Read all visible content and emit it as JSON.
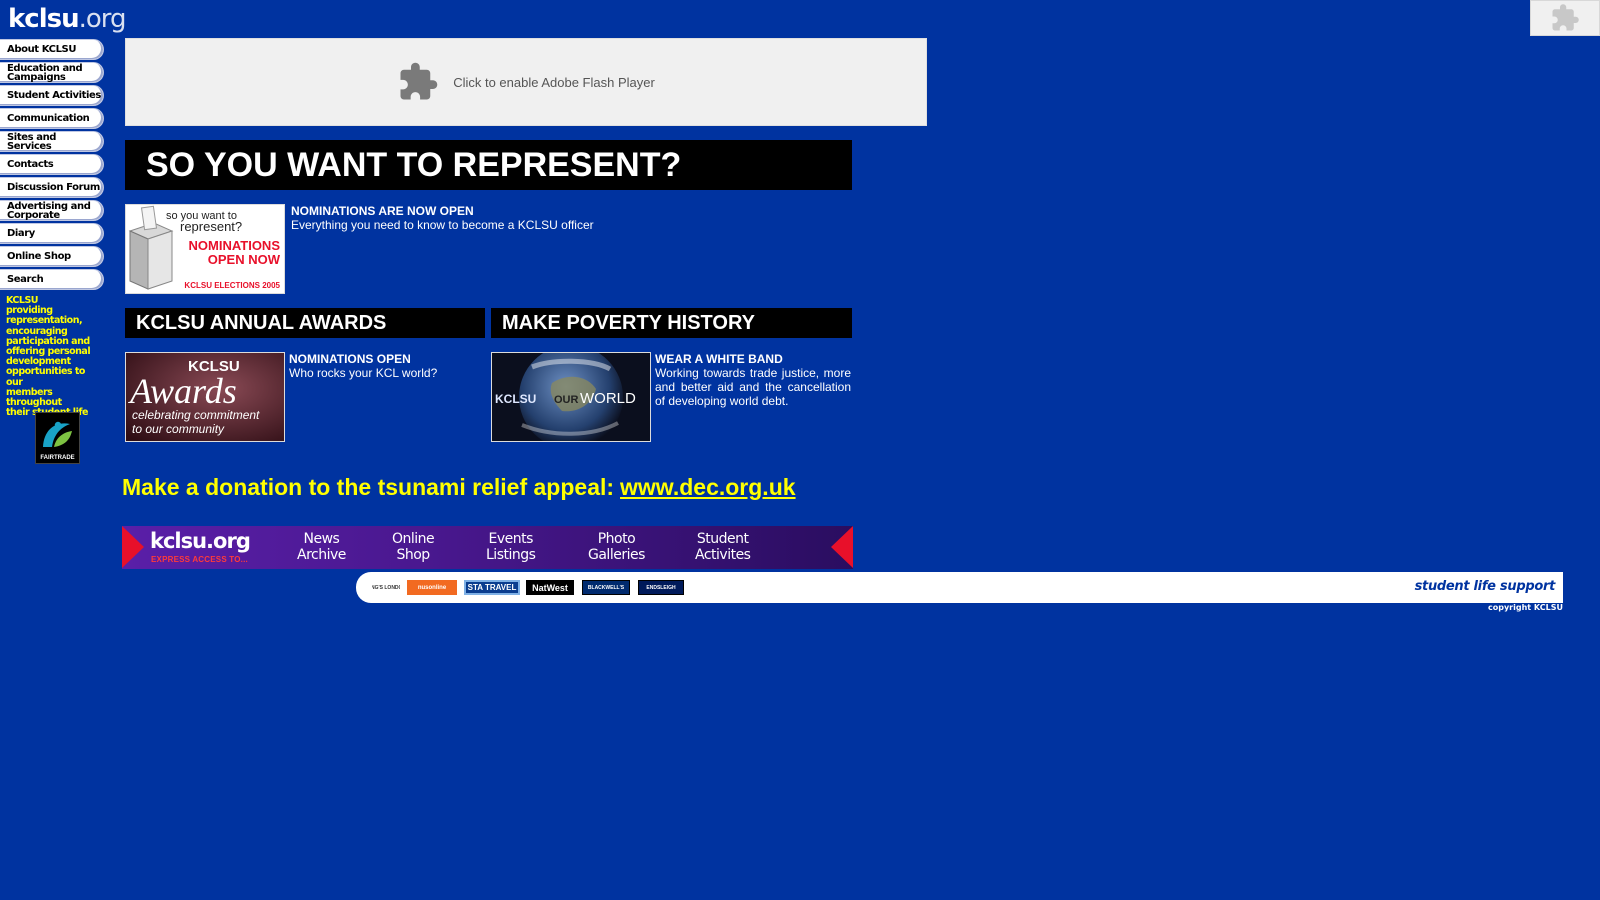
{
  "site": {
    "logo_bold": "kclsu",
    "logo_light": ".org"
  },
  "nav": {
    "items": [
      [
        "About KCLSU"
      ],
      [
        "Education and",
        "Campaigns"
      ],
      [
        "Student Activities"
      ],
      [
        "Communication"
      ],
      [
        "Sites and Services"
      ],
      [
        "Contacts"
      ],
      [
        "Discussion Forum"
      ],
      [
        "Advertising and",
        "Corporate"
      ],
      [
        "Diary"
      ],
      [
        "Online Shop"
      ],
      [
        "Search"
      ]
    ]
  },
  "tagline": [
    "KCLSU",
    "providing",
    "representation,",
    "encouraging",
    "participation and",
    "offering personal",
    "development",
    "opportunities to our",
    "members throughout",
    "their student life"
  ],
  "fairtrade_label": "FAIRTRADE",
  "flash": {
    "message": "Click to enable Adobe Flash Player"
  },
  "represent": {
    "heading": "SO YOU WANT TO REPRESENT?",
    "title": "NOMINATIONS ARE NOW OPEN",
    "desc": "Everything you need to know to become a KCLSU officer",
    "thumb": {
      "line1": "so you want to",
      "line2": "represent?",
      "line3": "NOMINATIONS",
      "line4": "OPEN NOW",
      "line5": "KCLSU ELECTIONS 2005"
    }
  },
  "awards": {
    "heading": "KCLSU ANNUAL AWARDS",
    "title": "NOMINATIONS OPEN",
    "desc": "Who rocks your KCL world?",
    "thumb": {
      "brand": "KCLSU",
      "word": "Awards",
      "line1": "celebrating commitment",
      "line2": "to our community"
    }
  },
  "poverty": {
    "heading": "MAKE POVERTY HISTORY",
    "title": "WEAR A WHITE BAND",
    "desc": "Working towards trade justice, more and better aid and the cancellation of developing world debt.",
    "thumb": {
      "brand": "KCLSU",
      "our": "OUR",
      "world": "WORLD"
    }
  },
  "tsunami": {
    "text": "Make a donation to the tsunami relief appeal:",
    "link": "www.dec.org.uk"
  },
  "express": {
    "logo": "kclsu.org",
    "sub": "EXPRESS ACCESS TO...",
    "links": [
      [
        "News",
        "Archive"
      ],
      [
        "Online",
        "Shop"
      ],
      [
        "Events",
        "Listings"
      ],
      [
        "Photo",
        "Galleries"
      ],
      [
        "Student",
        "Activites"
      ]
    ]
  },
  "sponsors": {
    "items": [
      "KING'S LONDON",
      "nusonline",
      "STA TRAVEL",
      "NatWest",
      "BLACKWELL'S",
      "ENDSLEIGH"
    ],
    "slogan": "student life support"
  },
  "copyright": "copyright KCLSU",
  "colors": {
    "page_bg": "#0033a0",
    "tagline": "#ffff00",
    "heading_bg": "#000000",
    "express_arrow": "#e8102a"
  }
}
